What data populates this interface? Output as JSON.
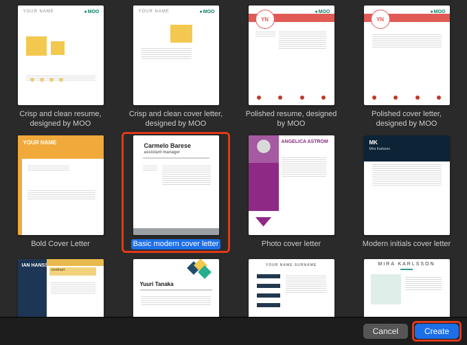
{
  "templates": [
    {
      "label": "Crisp and clean resume, designed by MOO",
      "selected": false,
      "kind": "moo-yellow-resume"
    },
    {
      "label": "Crisp and clean cover letter, designed by MOO",
      "selected": false,
      "kind": "moo-yellow-letter"
    },
    {
      "label": "Polished resume, designed by MOO",
      "selected": false,
      "kind": "moo-red-resume"
    },
    {
      "label": "Polished cover letter, designed by MOO",
      "selected": false,
      "kind": "moo-red-letter"
    },
    {
      "label": "Bold Cover Letter",
      "selected": false,
      "kind": "bold"
    },
    {
      "label": "Basic modern cover letter",
      "selected": true,
      "kind": "basic-modern",
      "name": "Carmelo Barese",
      "role": "assistant manager"
    },
    {
      "label": "Photo cover letter",
      "selected": false,
      "kind": "photo",
      "name": "ANGELICA ASTROM"
    },
    {
      "label": "Modern initials cover letter",
      "selected": false,
      "kind": "mk",
      "initials": "MK",
      "name": "Mira Karlsson"
    },
    {
      "label": "",
      "selected": false,
      "kind": "ian",
      "name": "IAN HANSSON",
      "tag": "contract"
    },
    {
      "label": "",
      "selected": false,
      "kind": "diamond",
      "name": "Yuuri Tanaka"
    },
    {
      "label": "",
      "selected": false,
      "kind": "nav",
      "name": "YOUR NAME SURNAME"
    },
    {
      "label": "",
      "selected": false,
      "kind": "mira",
      "name": "MIRA KARLSSON"
    }
  ],
  "footer": {
    "cancel": "Cancel",
    "create": "Create"
  },
  "header_placeholder": "YOUR NAME",
  "brand": "MOO"
}
